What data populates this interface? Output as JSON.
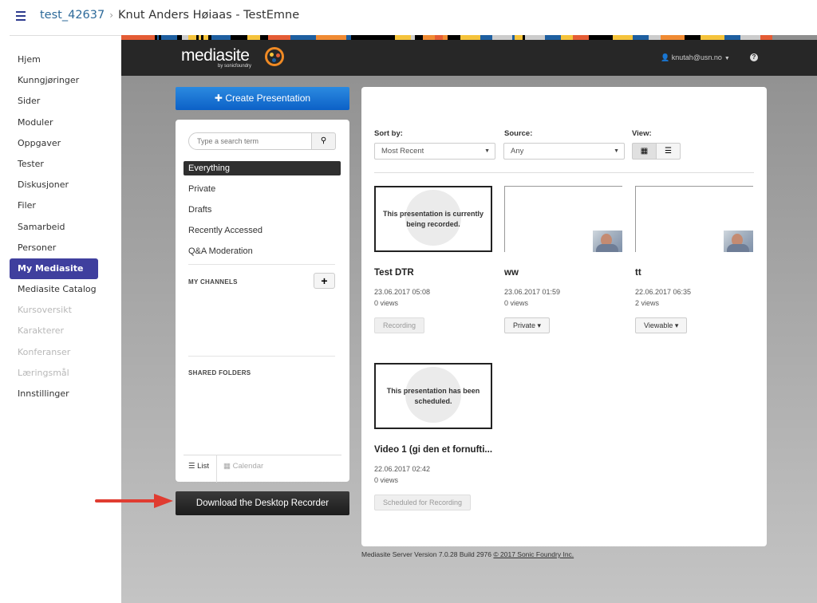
{
  "header": {
    "course_code": "test_42637",
    "course_title": "Knut Anders Høiaas - TestEmne"
  },
  "leftnav": {
    "items": [
      {
        "label": "Hjem",
        "state": "normal"
      },
      {
        "label": "Kunngjøringer",
        "state": "normal"
      },
      {
        "label": "Sider",
        "state": "normal"
      },
      {
        "label": "Moduler",
        "state": "normal"
      },
      {
        "label": "Oppgaver",
        "state": "normal"
      },
      {
        "label": "Tester",
        "state": "normal"
      },
      {
        "label": "Diskusjoner",
        "state": "normal"
      },
      {
        "label": "Filer",
        "state": "normal"
      },
      {
        "label": "Samarbeid",
        "state": "normal"
      },
      {
        "label": "Personer",
        "state": "normal"
      },
      {
        "label": "My Mediasite",
        "state": "active"
      },
      {
        "label": "Mediasite Catalog",
        "state": "normal"
      },
      {
        "label": "Kursoversikt",
        "state": "disabled"
      },
      {
        "label": "Karakterer",
        "state": "disabled"
      },
      {
        "label": "Konferanser",
        "state": "disabled"
      },
      {
        "label": "Læringsmål",
        "state": "disabled"
      },
      {
        "label": "Innstillinger",
        "state": "normal"
      }
    ]
  },
  "mediasite": {
    "logo_word": "mediasite",
    "logo_by": "by sonicfoundry",
    "user": "knutah@usn.no",
    "help_icon": "?",
    "create_label": "Create Presentation",
    "search_placeholder": "Type a search term",
    "filters": [
      "Everything",
      "Private",
      "Drafts",
      "Recently Accessed",
      "Q&A Moderation"
    ],
    "active_filter": "Everything",
    "my_channels": "MY CHANNELS",
    "shared_folders": "SHARED FOLDERS",
    "view_list": "List",
    "view_calendar": "Calendar",
    "download_label": "Download the Desktop Recorder",
    "sort_label": "Sort by:",
    "sort_value": "Most Recent",
    "source_label": "Source:",
    "source_value": "Any",
    "view_label": "View:",
    "cards": [
      {
        "title": "Test DTR",
        "date": "23.06.2017 05:08",
        "views": "0 views",
        "button": "Recording",
        "thumb_msg": "This presentation is currently being recorded.",
        "button_disabled": true
      },
      {
        "title": "ww",
        "date": "23.06.2017 01:59",
        "views": "0 views",
        "button": "Private ▾",
        "thumb_msg": "",
        "button_disabled": false
      },
      {
        "title": "tt",
        "date": "22.06.2017 06:35",
        "views": "2 views",
        "button": "Viewable ▾",
        "thumb_msg": "",
        "button_disabled": false
      },
      {
        "title": "Video 1 (gi den et fornufti...",
        "date": "22.06.2017 02:42",
        "views": "0 views",
        "button": "Scheduled for Recording",
        "thumb_msg": "This presentation has been scheduled.",
        "button_disabled": true
      }
    ],
    "footer_version": "Mediasite Server Version 7.0.28 Build 2976",
    "footer_copyright": "© 2017 Sonic Foundry Inc."
  },
  "colors": {
    "accent_nav": "#3f3f9e",
    "create_button": "#0c61c7",
    "header_dark": "#272727"
  }
}
